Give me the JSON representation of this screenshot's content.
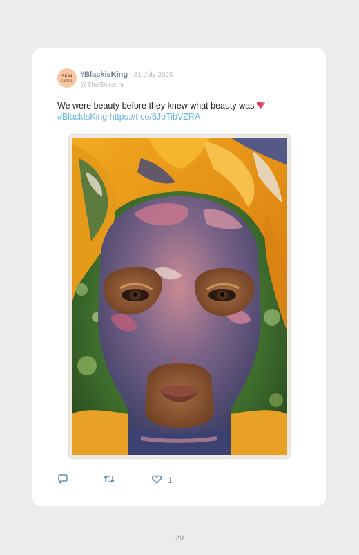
{
  "tweet": {
    "avatar": {
      "logo_top": "SKIN",
      "logo_bottom": "CAPITAL"
    },
    "hashtag_title": "#BlackisKing",
    "separator": " · ",
    "date": "31 July 2020",
    "username": "@TheShikemi",
    "text": "We were beauty before they knew what beauty was",
    "emoji": "two-hearts-emoji",
    "hashtag_link": "#BlackIsKing",
    "url_link": "https://t.co/6JoTibVZRA",
    "image": {
      "description_icon": "portrait-photo"
    },
    "actions": {
      "reply_icon": "reply-icon",
      "retweet_icon": "retweet-icon",
      "like_icon": "heart-icon",
      "like_count": "1"
    }
  },
  "page_number": "29",
  "colors": {
    "page_bg": "#ececec",
    "card_bg": "#ffffff",
    "link": "#66b6e6",
    "muted": "#b3bcc6",
    "icon": "#5d8fb8"
  }
}
